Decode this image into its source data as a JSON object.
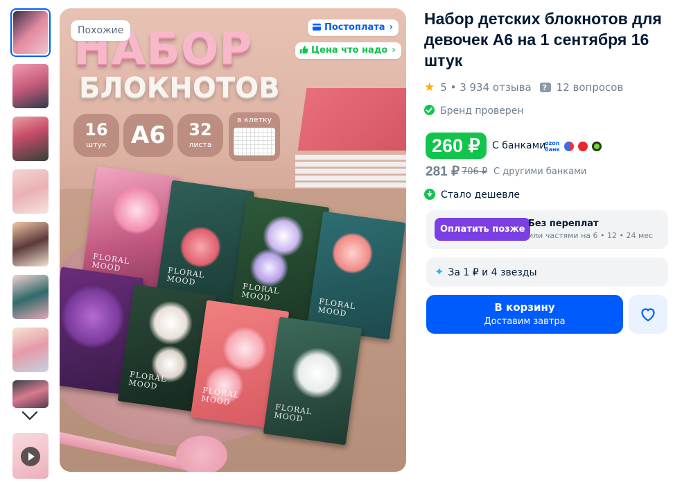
{
  "colors": {
    "accent": "#005bff",
    "green": "#10c44c",
    "purple": "#7b3fe4",
    "star": "#ffa800",
    "muted": "#707f8d",
    "text": "#001a34"
  },
  "gallery": {
    "thumbnails": [
      {
        "bg": "linear-gradient(135deg,#3b2d4a,#e28aa0 50%,#f0c3cf)",
        "active": true
      },
      {
        "bg": "linear-gradient(160deg,#f29bb0,#c45a7a 50%,#2f3b4a)",
        "active": false
      },
      {
        "bg": "linear-gradient(160deg,#e7a19e,#c94d6a 40%,#314138)",
        "active": false
      },
      {
        "bg": "linear-gradient(160deg,#f5d5d0,#eab1b4 50%,#f7e2e0)",
        "active": false
      },
      {
        "bg": "linear-gradient(160deg,#f0c7a8,#5b3a3a 50%,#f3dfcf)",
        "active": false
      },
      {
        "bg": "linear-gradient(160deg,#f3d3d2,#2f6a6a 50%,#e8a6b4)",
        "active": false
      },
      {
        "bg": "linear-gradient(160deg,#f6e4d4,#e59aa8 50%,#c6d3e0)",
        "active": false
      },
      {
        "bg": "linear-gradient(160deg,#36404a,#d77b8e 50%,#5a3850)",
        "active": false
      }
    ],
    "down_icon": "chevron-down-icon",
    "video_icon": "play-icon",
    "main_image": {
      "title_line1": "НАБОР",
      "title_line2": "БЛОКНОТОВ",
      "stat1_big": "16",
      "stat1_small": "штук",
      "stat2_big": "A6",
      "stat3_big": "32",
      "stat3_small": "листа",
      "grid_label": "в клетку",
      "notebook_label": "FLORAL\nMOOD"
    },
    "similar_chip": "Похожие",
    "postpay_chip": "Постоплата",
    "price_chip": "Цена что надо"
  },
  "product": {
    "title": "Набор детских блокнотов для девочек А6 на 1 сентября 16 штук",
    "rating": "5",
    "reviews": "3 934 отзыва",
    "questions": "12 вопросов",
    "brand_verified": "Бренд проверен",
    "price_bank": "260 ₽",
    "price_bank_note": "С банками",
    "ozon_bank_logo_line1": "ozon",
    "ozon_bank_logo_line2": "банк",
    "price_other": "281 ₽",
    "price_old": "706 ₽",
    "price_other_note": "С другими банками",
    "cheaper_text": "Стало дешевле",
    "pay_later_button": "Оплатить позже",
    "pay_later_title": "Без переплат",
    "pay_later_sub": "или частями на 6 • 12 • 24 мес",
    "stars_text": "За 1 ₽ и 4 звезды",
    "cart_button": "В корзину",
    "cart_sub": "Доставим завтра",
    "favorite_icon": "heart-icon"
  }
}
